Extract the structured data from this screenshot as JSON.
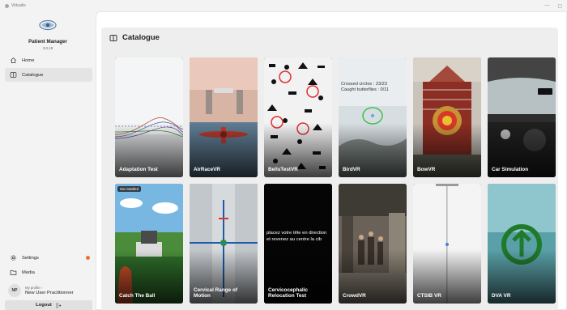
{
  "window": {
    "title": "Virtualis"
  },
  "brand": {
    "name": "Patient Manager",
    "version": "3.0.19"
  },
  "nav": {
    "items": [
      {
        "label": "Home",
        "icon": "home-icon",
        "active": false
      },
      {
        "label": "Catalogue",
        "icon": "book-icon",
        "active": true
      }
    ]
  },
  "bottom_nav": {
    "settings": {
      "label": "Settings",
      "icon": "gear-icon",
      "notification_color": "#e8742c"
    },
    "media": {
      "label": "Media",
      "icon": "folder-icon"
    }
  },
  "profile": {
    "initials": "NP",
    "label": "My profile",
    "name": "New User Practitionner"
  },
  "logout": {
    "label": "Logout"
  },
  "page": {
    "title": "Catalogue"
  },
  "cards": [
    {
      "title": "Adaptation Test",
      "theme": "graph"
    },
    {
      "title": "AirRaceVR",
      "theme": "plane"
    },
    {
      "title": "BellsTestVR",
      "theme": "bells"
    },
    {
      "title": "BirdVR",
      "theme": "bird",
      "overlay": [
        "Crossed circles : 23/23",
        "Caught butterflies : 0/11"
      ]
    },
    {
      "title": "BowVR",
      "theme": "bow"
    },
    {
      "title": "Car Simulation",
      "theme": "car"
    },
    {
      "title": "Catch The Ball",
      "theme": "ball",
      "tag": "Not installed"
    },
    {
      "title": "Cervical Range of Motion",
      "theme": "cervical"
    },
    {
      "title": "Cervicocephalic Relocation Test",
      "theme": "relocation",
      "overlay": [
        "placez votre tête en direction",
        "et revenez au centre la cib"
      ]
    },
    {
      "title": "CrowdVR",
      "theme": "crowd"
    },
    {
      "title": "CTSIB VR",
      "theme": "ctsib"
    },
    {
      "title": "DVA VR",
      "theme": "dva"
    }
  ]
}
